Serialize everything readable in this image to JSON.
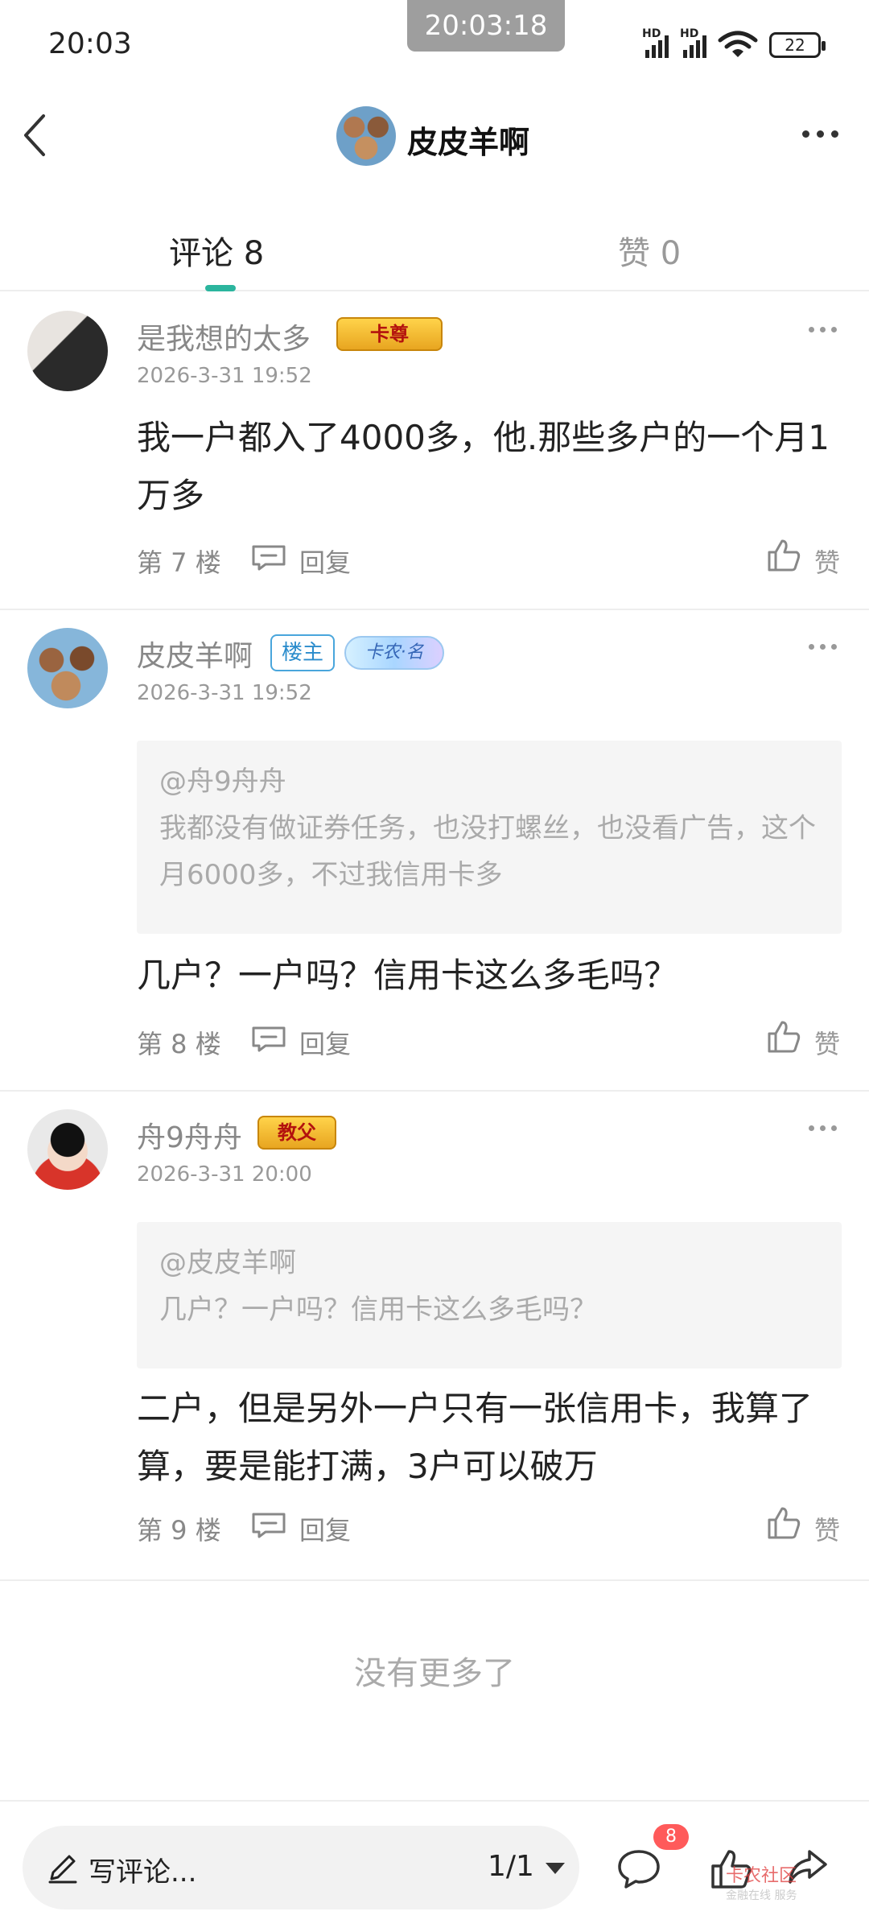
{
  "status_bar": {
    "time": "20:03",
    "overlay_time": "20:03:18",
    "battery": "22"
  },
  "header": {
    "title": "皮皮羊啊"
  },
  "tabs": [
    {
      "label": "评论 8"
    },
    {
      "label": "赞 0"
    }
  ],
  "comments": [
    {
      "name": "是我想的太多",
      "badge": "卡尊",
      "time": "2026-3-31 19:52",
      "quote": null,
      "text": "我一户都入了4000多，他.那些多户的一个月1万多",
      "floor": "第 7 楼",
      "reply": "回复",
      "like": "赞"
    },
    {
      "name": "皮皮羊啊",
      "badge_owner": "楼主",
      "badge": "卡农·名",
      "time": "2026-3-31 19:52",
      "quote": {
        "at": "@舟9舟舟",
        "text": "我都没有做证券任务，也没打螺丝，也没看广告，这个月6000多，不过我信用卡多"
      },
      "text": "几户？一户吗？信用卡这么多毛吗？",
      "floor": "第 8 楼",
      "reply": "回复",
      "like": "赞"
    },
    {
      "name": "舟9舟舟",
      "badge": "教父",
      "time": "2026-3-31 20:00",
      "quote": {
        "at": "@皮皮羊啊",
        "text": "几户？一户吗？信用卡这么多毛吗？"
      },
      "text": "二户，但是另外一户只有一张信用卡，我算了算，要是能打满，3户可以破万",
      "floor": "第 9 楼",
      "reply": "回复",
      "like": "赞"
    }
  ],
  "no_more": "没有更多了",
  "bottom_bar": {
    "placeholder": "写评论...",
    "page_indicator": "1/1",
    "comment_count": "8",
    "watermark": "卡农社区",
    "watermark_sub": "金融在线 服务"
  },
  "colors": {
    "accent": "#2bb59e",
    "badge_red": "#ff5a5a",
    "owner_blue": "#2b8ccc"
  },
  "icons": [
    "back-icon",
    "more-icon",
    "reply-icon",
    "like-icon",
    "pen-icon",
    "comment-icon",
    "share-icon"
  ]
}
